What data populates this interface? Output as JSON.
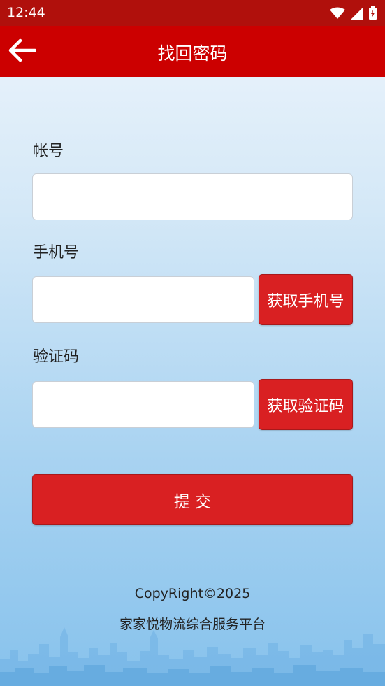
{
  "status_bar": {
    "time": "12:44"
  },
  "app_bar": {
    "title": "找回密码"
  },
  "form": {
    "account_label": "帐号",
    "account_value": "",
    "phone_label": "手机号",
    "phone_value": "",
    "get_phone_button": "获取手机号",
    "code_label": "验证码",
    "code_value": "",
    "get_code_button": "获取验证码",
    "submit_button": "提 交"
  },
  "footer": {
    "copyright": "CopyRight©2025",
    "platform": "家家悦物流综合服务平台"
  },
  "colors": {
    "status_bar": "#b0100c",
    "app_bar": "#cc0000",
    "button": "#d92022",
    "background_top": "#eef5fc",
    "background_bottom": "#87c2ec"
  },
  "icons": {
    "status": [
      "wifi-icon",
      "signal-icon",
      "battery-icon"
    ],
    "back": "back-arrow-icon"
  }
}
